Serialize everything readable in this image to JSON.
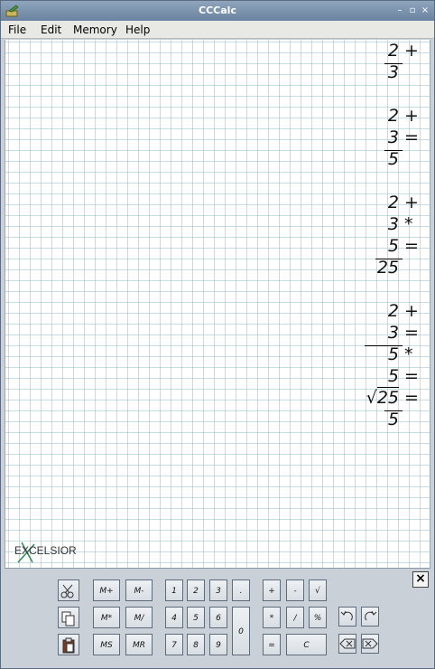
{
  "window": {
    "title": "CCCalc"
  },
  "menu": [
    {
      "label": "File"
    },
    {
      "label": "Edit"
    },
    {
      "label": "Memory"
    },
    {
      "label": "Help"
    }
  ],
  "tape": {
    "blocks": [
      {
        "lines": [
          {
            "value": "2",
            "op": "+"
          },
          {
            "value": "3",
            "op": ""
          }
        ]
      },
      {
        "lines": [
          {
            "value": "2",
            "op": "+"
          },
          {
            "value": "3",
            "op": "="
          },
          {
            "value": "5",
            "op": ""
          }
        ]
      },
      {
        "lines": [
          {
            "value": "2",
            "op": "+"
          },
          {
            "value": "3",
            "op": "*"
          },
          {
            "value": "5",
            "op": "="
          },
          {
            "value": "25",
            "op": ""
          }
        ]
      },
      {
        "lines": [
          {
            "value": "2",
            "op": "+"
          },
          {
            "value": "3",
            "op": "="
          },
          {
            "value": "5",
            "op": "*"
          },
          {
            "value": "5",
            "op": "="
          },
          {
            "value": "25",
            "op": "=",
            "sqrt": true
          },
          {
            "value": "5",
            "op": ""
          }
        ]
      }
    ]
  },
  "logo": {
    "text": "EXCELSIOR"
  },
  "keypad": {
    "edit_icons": [
      "cut-icon",
      "copy-icon",
      "paste-icon"
    ],
    "memory": [
      "M+",
      "M-",
      "M*",
      "M/",
      "MS",
      "MR"
    ],
    "digits": [
      "1",
      "2",
      "3",
      ".",
      "4",
      "5",
      "6",
      "0",
      "7",
      "8",
      "9"
    ],
    "operators": [
      "+",
      "-",
      "√",
      "*",
      "/",
      "%",
      "=",
      "C"
    ],
    "actions": [
      "undo-icon",
      "redo-icon",
      "backspace-icon",
      "clear-entry-icon"
    ],
    "close_label": "×"
  }
}
